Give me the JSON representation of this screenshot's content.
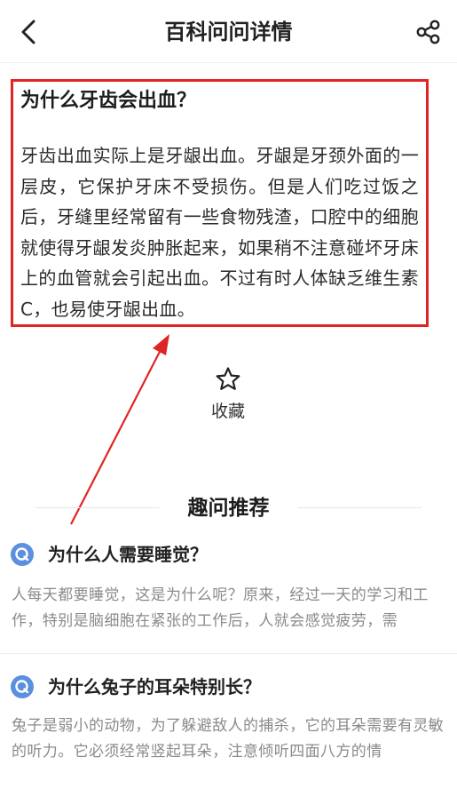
{
  "header": {
    "title": "百科问问详情",
    "back_icon": "chevron-left-icon",
    "share_icon": "share-icon"
  },
  "article": {
    "title": "为什么牙齿会出血？",
    "body": "牙齿出血实际上是牙龈出血。牙龈是牙颈外面的一层皮，它保护牙床不受损伤。但是人们吃过饭之后，牙缝里经常留有一些食物残渣，口腔中的细胞就使得牙龈发炎肿胀起来，如果稍不注意碰坏牙床上的血管就会引起出血。不过有时人体缺乏维生素C，也易使牙龈出血。",
    "highlight_color": "#e02424"
  },
  "favorite": {
    "label": "收藏",
    "icon": "star-outline-icon"
  },
  "recommend": {
    "heading": "趣问推荐",
    "icon_color": "#5b8fe0",
    "items": [
      {
        "title": "为什么人需要睡觉？",
        "summary": "人每天都要睡觉，这是为什么呢？原来，经过一天的学习和工作，特别是脑细胞在紧张的工作后，人就会感觉疲劳，需"
      },
      {
        "title": "为什么兔子的耳朵特别长？",
        "summary": "兔子是弱小的动物，为了躲避敌人的捕杀，它的耳朵需要有灵敏的听力。它必须经常竖起耳朵，注意倾听四面八方的情"
      }
    ]
  }
}
